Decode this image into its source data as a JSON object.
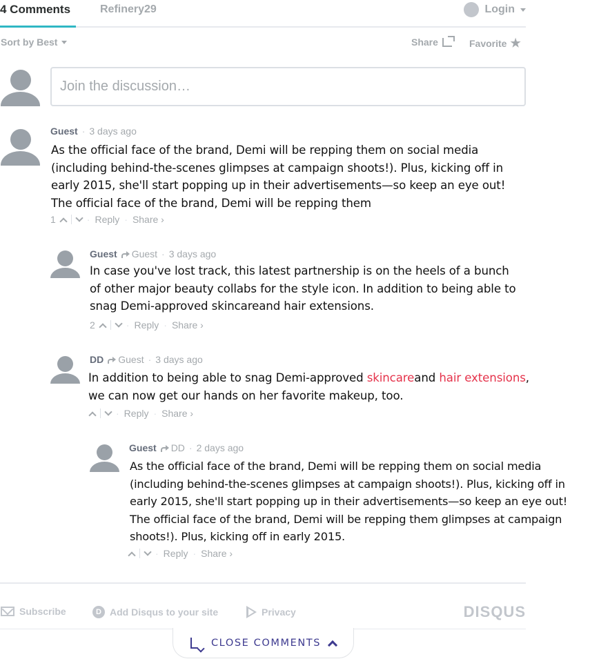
{
  "header": {
    "comments_tab": "4 Comments",
    "site_tab": "Refinery29",
    "login_label": "Login"
  },
  "toolbar": {
    "sort_label": "Sort by Best",
    "share_label": "Share",
    "favorite_label": "Favorite"
  },
  "compose": {
    "placeholder": "Join the discussion…"
  },
  "comments": [
    {
      "author": "Guest",
      "reply_to": "",
      "time": "3 days ago",
      "lines": [
        "As the official face of the brand, Demi will be repping them on social media",
        "(including behind-the-scenes glimpses at campaign shoots!). Plus, kicking off in",
        "early 2015, she'll start popping up in their advertisements—so keep an eye out!",
        "The official face of the brand, Demi will be repping them"
      ],
      "votes": "1",
      "reply_label": "Reply",
      "share_label": "Share ›"
    },
    {
      "author": "Guest",
      "reply_to": "Guest",
      "time": "3 days ago",
      "lines": [
        "In case you've lost track, this latest partnership is on the heels of a bunch",
        "of other major beauty collabs for the style icon. In addition to being able to",
        "snag Demi-approved skincareand hair extensions."
      ],
      "votes": "2",
      "reply_label": "Reply",
      "share_label": "Share ›"
    },
    {
      "author": "DD",
      "reply_to": "Guest",
      "time": "3 days ago",
      "line1_prefix": "In addition to being able to snag Demi-approved ",
      "link1": "skincare",
      "line1_mid": "and ",
      "link2": "hair extensions",
      "line1_suffix": ",",
      "line2": "we can now get our hands on her favorite makeup, too.",
      "votes": "",
      "reply_label": "Reply",
      "share_label": "Share ›"
    },
    {
      "author": "Guest",
      "reply_to": "DD",
      "time": "2 days ago",
      "lines": [
        "As the official face of the brand, Demi will be repping them on social media",
        "(including behind-the-scenes glimpses at campaign shoots!). Plus, kicking off in",
        "early 2015, she'll start popping up in their advertisements—so keep an eye out!",
        "The official face of the brand, Demi will be repping them glimpses at campaign",
        "shoots!). Plus, kicking off in early 2015."
      ],
      "votes": "",
      "reply_label": "Reply",
      "share_label": "Share ›"
    }
  ],
  "footer": {
    "subscribe": "Subscribe",
    "add_disqus": "Add Disqus to your site",
    "privacy": "Privacy",
    "logo": "DISQUS"
  },
  "close_comments": {
    "label": "CLOSE COMMENTS"
  },
  "colors": {
    "accent_tab": "#2fb7c4",
    "link": "#e5334b",
    "close_button": "#3d3a8f"
  }
}
